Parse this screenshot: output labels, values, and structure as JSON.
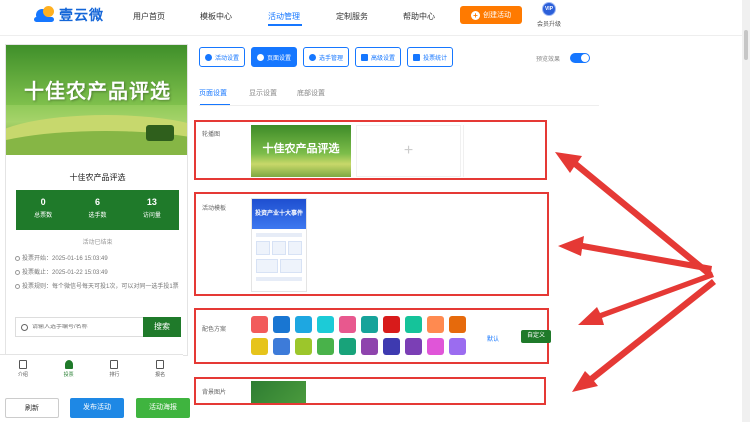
{
  "nav": {
    "logo_text": "壹云微",
    "items": [
      {
        "label": "用户首页",
        "active": false
      },
      {
        "label": "模板中心",
        "active": false
      },
      {
        "label": "活动管理",
        "active": true
      },
      {
        "label": "定制服务",
        "active": false
      },
      {
        "label": "帮助中心",
        "active": false
      }
    ],
    "create_button": "创建活动",
    "vip_badge": "VIP",
    "vip_label": "会员升级"
  },
  "preview": {
    "banner_title": "十佳农产品评选",
    "activity_title": "十佳农产品评选",
    "stats": [
      {
        "value": "0",
        "label": "总票数"
      },
      {
        "value": "6",
        "label": "选手数"
      },
      {
        "value": "13",
        "label": "访问量"
      }
    ],
    "status": "活动已结束",
    "info": [
      "投票开始：2025-01-16 15:03:49",
      "投票截止：2025-01-22 15:03:49",
      "投票规则：每个微信号每天可投1次，可以对同一选手投1票"
    ],
    "search_placeholder": "请输入选手编号/名称",
    "search_button": "搜索",
    "tabs": [
      {
        "label": "介绍",
        "icon": "doc-icon",
        "active": false
      },
      {
        "label": "投票",
        "icon": "user-icon",
        "active": true
      },
      {
        "label": "排行",
        "icon": "rank-icon",
        "active": false
      },
      {
        "label": "报名",
        "icon": "signup-icon",
        "active": false
      }
    ]
  },
  "bottom_buttons": {
    "refresh": "刷新",
    "publish": "发布活动",
    "poster": "活动海报"
  },
  "toolbar": {
    "buttons": [
      {
        "label": "活动设置",
        "active": false
      },
      {
        "label": "页面设置",
        "active": true
      },
      {
        "label": "选手管理",
        "active": false
      },
      {
        "label": "高级设置",
        "active": false
      },
      {
        "label": "投票统计",
        "active": false
      }
    ],
    "preview_toggle_label": "预览效果",
    "preview_toggle_on": true
  },
  "subtabs": [
    {
      "label": "页面设置",
      "active": true
    },
    {
      "label": "显示设置",
      "active": false
    },
    {
      "label": "底部设置",
      "active": false
    }
  ],
  "sections": {
    "carousel_label": "轮播图",
    "carousel_image_title": "十佳农产品评选",
    "add_icon": "+",
    "template_label": "活动模板",
    "template_image_title": "投资产业十大事件",
    "color_label": "配色方案",
    "color_default": "默认",
    "color_custom": "自定义",
    "bg_label": "背景图片"
  },
  "colors": {
    "primary": "#1677ff",
    "accent_orange": "#ff7a00",
    "theme_green": "#1f7a2a",
    "highlight_red": "#e53935",
    "swatches_row1": [
      "#f25b5b",
      "#1976d2",
      "#1ea7e1",
      "#1ccbd7",
      "#e8588e",
      "#16a39a",
      "#d81b1b",
      "#15c39a",
      "#ff8a50",
      "#e66a0c"
    ],
    "swatches_row2": [
      "#e6c41b",
      "#3d7bd9",
      "#9cc62b",
      "#49b24a",
      "#18a37a",
      "#8e44ad",
      "#3e3ab0",
      "#7b3fb5",
      "#e055d8",
      "#9b6cf0"
    ]
  }
}
